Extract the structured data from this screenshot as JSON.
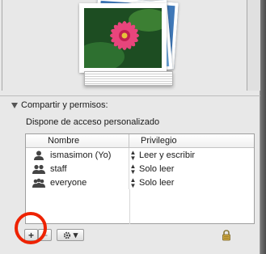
{
  "sharing": {
    "section_title": "Compartir y permisos:",
    "access_text": "Dispone de acceso personalizado",
    "columns": {
      "name": "Nombre",
      "privilege": "Privilegio"
    },
    "rows": [
      {
        "name": "ismasimon (Yo)",
        "privilege": "Leer y escribir",
        "icon": "single-user-icon"
      },
      {
        "name": "staff",
        "privilege": "Solo leer",
        "icon": "group-icon"
      },
      {
        "name": "everyone",
        "privilege": "Solo leer",
        "icon": "everyone-icon"
      }
    ]
  },
  "toolbar": {
    "add_label": "+",
    "remove_label": "−",
    "gear_label": "▾"
  },
  "colors": {
    "highlight_circle": "#ee2200"
  }
}
